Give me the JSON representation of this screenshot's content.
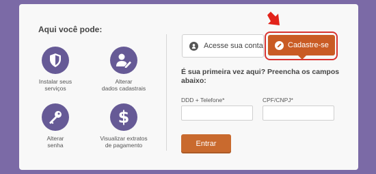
{
  "left_panel": {
    "title": "Aqui você pode:",
    "features": [
      {
        "icon": "shield-icon",
        "label_line1": "Instalar seus",
        "label_line2": "serviços"
      },
      {
        "icon": "user-edit-icon",
        "label_line1": "Alterar",
        "label_line2": "dados cadastrais"
      },
      {
        "icon": "key-icon",
        "label_line1": "Alterar",
        "label_line2": "senha"
      },
      {
        "icon": "dollar-icon",
        "label_line1": "Visualizar extratos",
        "label_line2": "de pagamento"
      }
    ]
  },
  "tabs": {
    "login_label": "Acesse sua conta",
    "signup_label": "Cadastre-se"
  },
  "form": {
    "heading": "É sua primeira vez aqui? Preencha os campos abaixo:",
    "phone_label": "DDD + Telefone*",
    "phone_value": "",
    "cpf_label": "CPF/CNPJ*",
    "cpf_value": "",
    "submit_label": "Entrar"
  },
  "colors": {
    "background": "#7b6aa6",
    "icon_purple": "#665a96",
    "accent_orange": "#c95b24",
    "highlight_red": "#d8332f"
  }
}
